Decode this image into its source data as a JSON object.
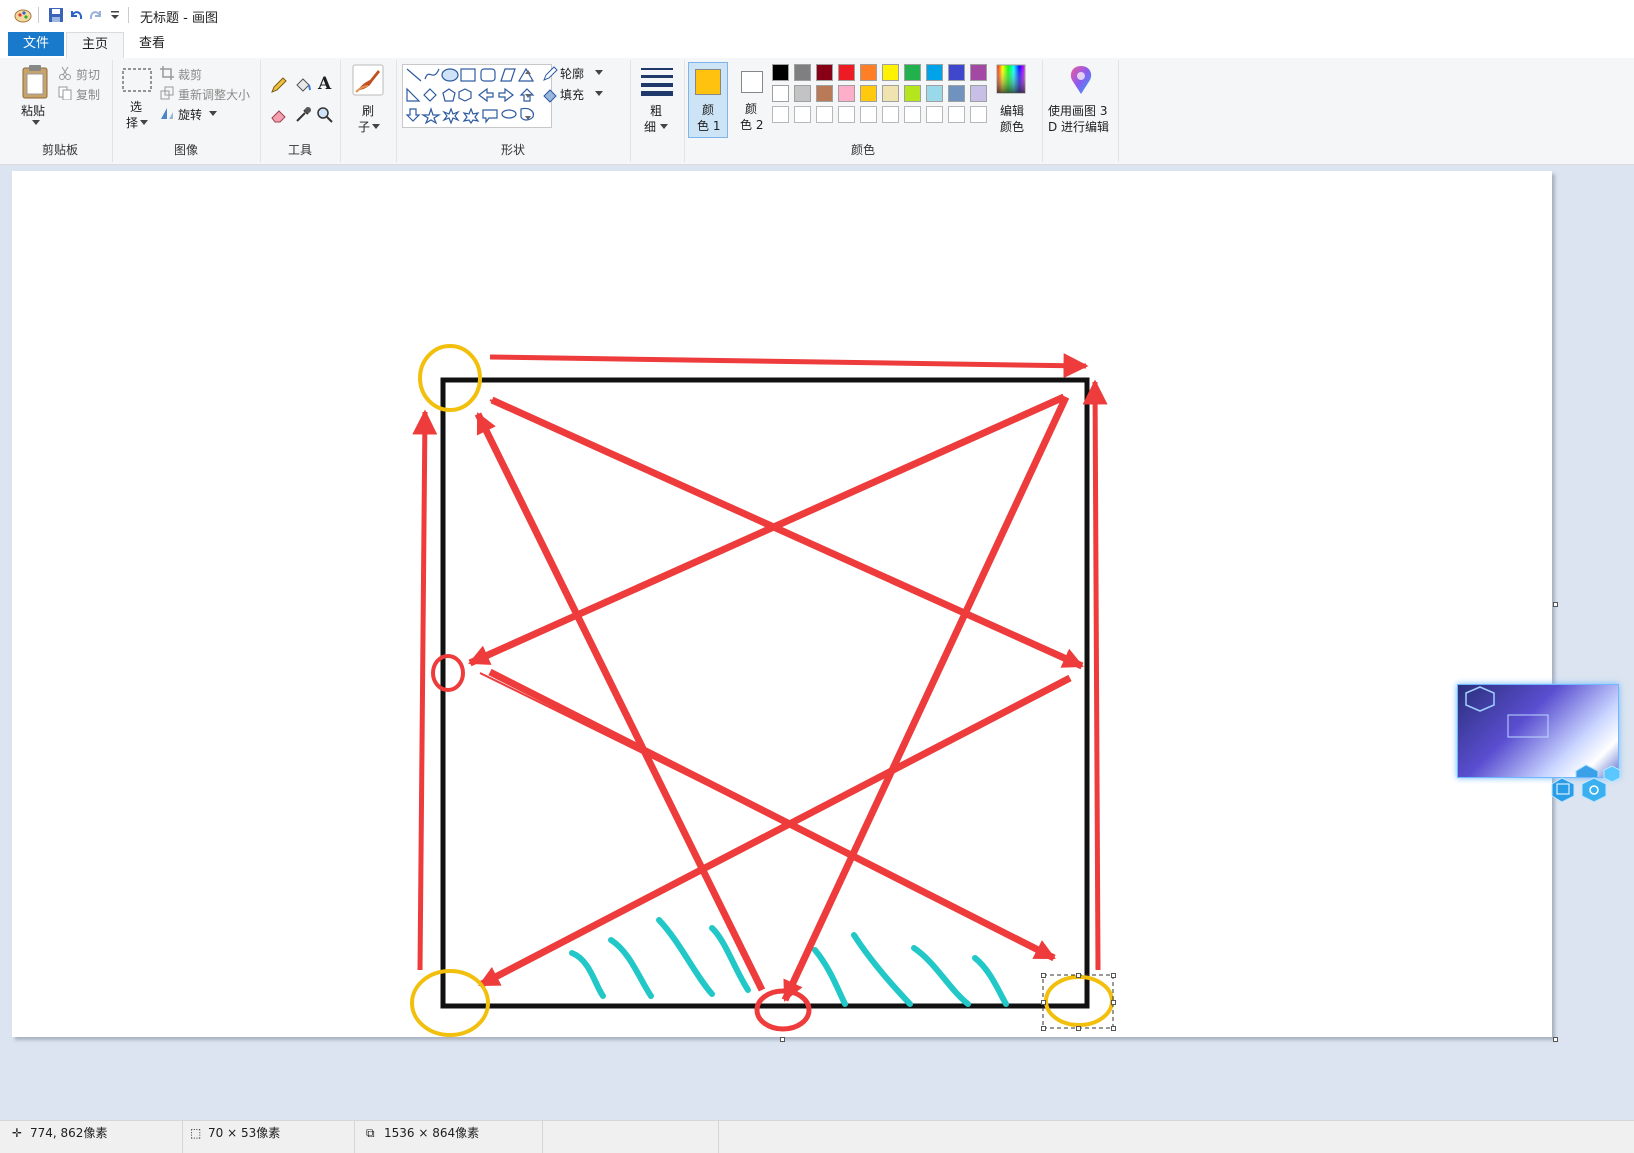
{
  "window": {
    "title": "无标题 - 画图"
  },
  "tabs": [
    {
      "label": "文件"
    },
    {
      "label": "主页"
    },
    {
      "label": "查看"
    }
  ],
  "ribbon": {
    "clipboard": {
      "group": "剪贴板",
      "paste": "粘贴",
      "cut": "剪切",
      "copy": "复制"
    },
    "image": {
      "group": "图像",
      "select_1": "选",
      "select_2": "择",
      "crop": "裁剪",
      "resize": "重新调整大小",
      "rotate": "旋转"
    },
    "tools": {
      "group": "工具",
      "text_glyph": "A"
    },
    "brushes": {
      "label_1": "刷",
      "label_2": "子"
    },
    "shapes": {
      "group": "形状",
      "outline": "轮廓",
      "fill": "填充"
    },
    "size": {
      "label_1": "粗",
      "label_2": "细"
    },
    "colors": {
      "group": "颜色",
      "color1_a": "颜",
      "color1_b": "色 1",
      "color2_a": "颜",
      "color2_b": "色 2",
      "edit_a": "编辑",
      "edit_b": "颜色",
      "color1": "#ffc20e",
      "color2": "#ffffff",
      "palette_row1": [
        "#000000",
        "#7f7f7f",
        "#880015",
        "#ed1c24",
        "#ff7f27",
        "#fff200",
        "#22b14c",
        "#00a2e8",
        "#3f48cc",
        "#a349a4"
      ],
      "palette_row2": [
        "#ffffff",
        "#c3c3c3",
        "#b97a57",
        "#ffaec9",
        "#ffc90e",
        "#efe4b0",
        "#b5e61d",
        "#99d9ea",
        "#7092be",
        "#c8bfe7"
      ]
    },
    "paint3d": {
      "label_1": "使用画图 3",
      "label_2": "D 进行编辑"
    }
  },
  "status": {
    "cursor": "774, 862像素",
    "selection": "70 × 53像素",
    "canvas_size": "1536 × 864像素"
  }
}
